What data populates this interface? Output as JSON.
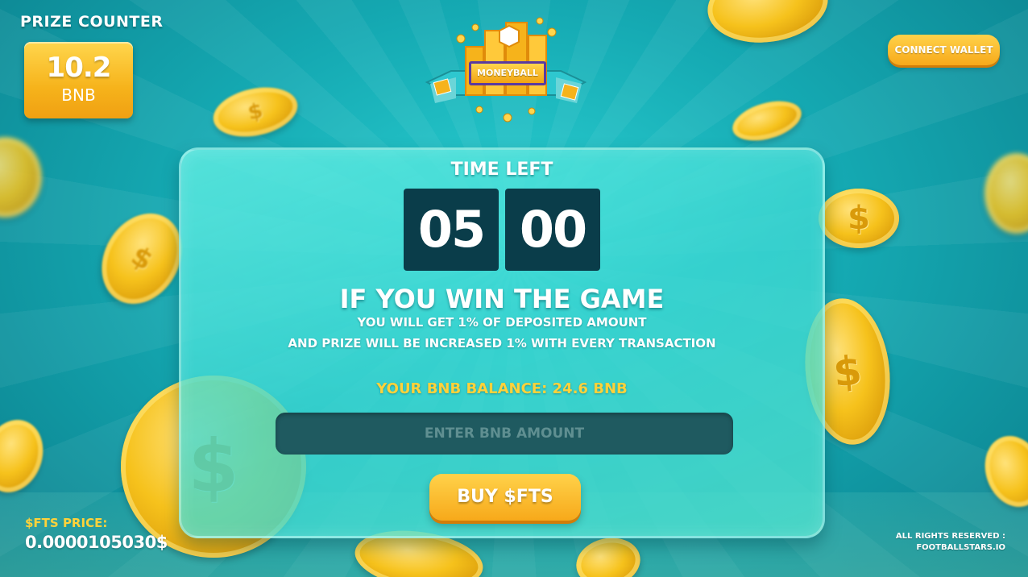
{
  "prize_counter": {
    "title": "PRIZE COUNTER",
    "value": "10.2",
    "unit": "BNB"
  },
  "logo": {
    "text": "MONEYBALL",
    "icon": "moneyball-logo-icon"
  },
  "header": {
    "connect_wallet_label": "CONNECT WALLET"
  },
  "panel": {
    "time_left_title": "TIME LEFT",
    "timer_minutes": "05",
    "timer_seconds": "00",
    "win_title": "IF YOU WIN THE GAME",
    "win_line1": "YOU WILL GET 1% OF DEPOSITED AMOUNT",
    "win_line2": "AND PRIZE WILL BE INCREASED 1% WITH EVERY TRANSACTION",
    "balance_text": "YOUR BNB BALANCE: 24.6 BNB",
    "amount_input": {
      "value": "",
      "placeholder": "ENTER BNB AMOUNT"
    },
    "buy_label": "BUY $FTS"
  },
  "footer": {
    "price_label": "$FTS PRICE:",
    "price_value": "0.0000105030$",
    "rights_line1": "ALL RIGHTS RESERVED :",
    "rights_line2": "FOOTBALLSTARS.IO"
  },
  "colors": {
    "accent_gold": "#f7a91a",
    "balance_yellow": "#ffd23a",
    "timer_bg": "#0a3d4a",
    "input_bg": "#1f5a60",
    "panel_teal": "#3cd7d2"
  }
}
